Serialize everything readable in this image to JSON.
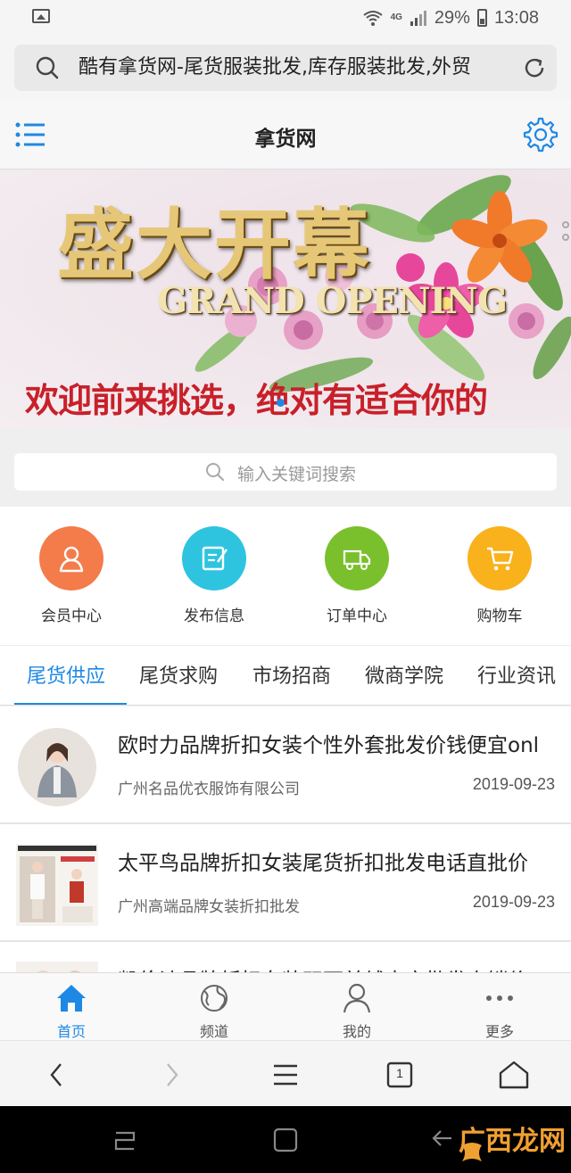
{
  "status_bar": {
    "battery": "29%",
    "time": "13:08",
    "network": "4G"
  },
  "browser": {
    "url_title": "酷有拿货网-尾货服装批发,库存服装批发,外贸",
    "tab_count": "1"
  },
  "header": {
    "title": "拿货网"
  },
  "banner": {
    "headline": "盛大开幕",
    "subline": "GRAND OPENING",
    "welcome": "欢迎前来挑选，绝对有适合你的"
  },
  "search": {
    "placeholder": "输入关键词搜索"
  },
  "quick_links": [
    {
      "label": "会员中心",
      "icon": "user-icon",
      "color": "#f47c4a"
    },
    {
      "label": "发布信息",
      "icon": "edit-icon",
      "color": "#2ec4e0"
    },
    {
      "label": "订单中心",
      "icon": "truck-icon",
      "color": "#7ac02c"
    },
    {
      "label": "购物车",
      "icon": "cart-icon",
      "color": "#f9b11c"
    }
  ],
  "tabs": [
    {
      "label": "尾货供应",
      "active": true
    },
    {
      "label": "尾货求购"
    },
    {
      "label": "市场招商"
    },
    {
      "label": "微商学院"
    },
    {
      "label": "行业资讯"
    }
  ],
  "listings": [
    {
      "title": "欧时力品牌折扣女装个性外套批发价钱便宜onl",
      "company": "广州名品优衣服饰有限公司",
      "date": "2019-09-23"
    },
    {
      "title": "太平鸟品牌折扣女装尾货折扣批发电话直批价",
      "company": "广州高端品牌女装折扣批发",
      "date": "2019-09-23"
    },
    {
      "title": "凯伦诗品牌折扣女装双面羊绒大衣批发直销价",
      "company": "",
      "date": ""
    }
  ],
  "bottom_nav": [
    {
      "label": "首页",
      "icon": "home-icon",
      "active": true
    },
    {
      "label": "频道",
      "icon": "globe-icon"
    },
    {
      "label": "我的",
      "icon": "person-icon"
    },
    {
      "label": "更多",
      "icon": "more-icon"
    }
  ],
  "watermark": "广西龙网",
  "colors": {
    "accent": "#1e88e5",
    "banner_red": "#c8202a",
    "banner_gold": "#e6c777"
  }
}
